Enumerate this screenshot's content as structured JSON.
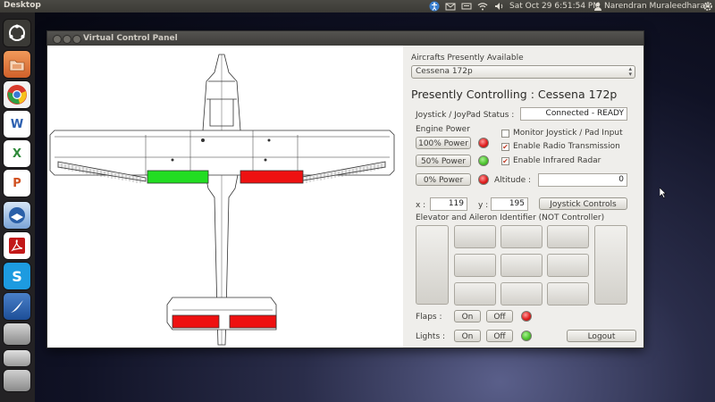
{
  "top_panel": {
    "title": "Desktop",
    "datetime": "Sat Oct 29  6:51:54 PM",
    "user": "Narendran Muraleedharan"
  },
  "launcher": {
    "items": [
      {
        "name": "ubuntu-home-icon",
        "color": "#3b3a36"
      },
      {
        "name": "files-icon",
        "color": "#e07a3a"
      },
      {
        "name": "chrome-icon",
        "color": "#d64a3a"
      },
      {
        "name": "word-icon",
        "color": "#2b5fb0"
      },
      {
        "name": "excel-icon",
        "color": "#2f8a3a"
      },
      {
        "name": "powerpoint-icon",
        "color": "#d05020"
      },
      {
        "name": "thunderbird-icon",
        "color": "#2a5fa8"
      },
      {
        "name": "pdf-reader-icon",
        "color": "#c21818"
      },
      {
        "name": "skype-icon",
        "color": "#1d9be0"
      },
      {
        "name": "media-icon",
        "color": "#2a64b0"
      },
      {
        "name": "workspace-icon",
        "color": "#888"
      }
    ]
  },
  "window": {
    "title": "Virtual Control Panel"
  },
  "panel": {
    "aircraft_label": "Aircrafts Presently Available",
    "aircraft_selected": "Cessena 172p",
    "controlling": "Presently Controlling : Cessena 172p",
    "status_label": "Joystick / JoyPad Status :",
    "status_value": "Connected - READY",
    "engine_label": "Engine Power",
    "power_100": "100% Power",
    "power_50": "50% Power",
    "power_0": "0% Power",
    "monitor_label": "Monitor Joystick / Pad Input",
    "monitor_checked": false,
    "radio_label": "Enable Radio Transmission",
    "radio_checked": true,
    "radar_label": "Enable Infrared Radar",
    "radar_checked": true,
    "altitude_label": "Altitude :",
    "altitude_value": "0",
    "x_label": "x :",
    "x_value": "119",
    "y_label": "y :",
    "y_value": "195",
    "joystick_btn": "Joystick Controls",
    "elevator_label": "Elevator and Aileron Identifier (NOT Controller)",
    "flaps_label": "Flaps :",
    "lights_label": "Lights :",
    "on_label": "On",
    "off_label": "Off",
    "logout_btn": "Logout"
  },
  "status_colors": {
    "power_100_led": "red",
    "power_50_led": "green",
    "power_0_led": "red",
    "flaps_led": "red",
    "lights_led": "green"
  },
  "surfaces": {
    "left_aileron": "#22dd22",
    "right_aileron": "#ee1111",
    "left_elevator": "#ee1111",
    "right_elevator": "#ee1111"
  },
  "checkmark": "✔"
}
